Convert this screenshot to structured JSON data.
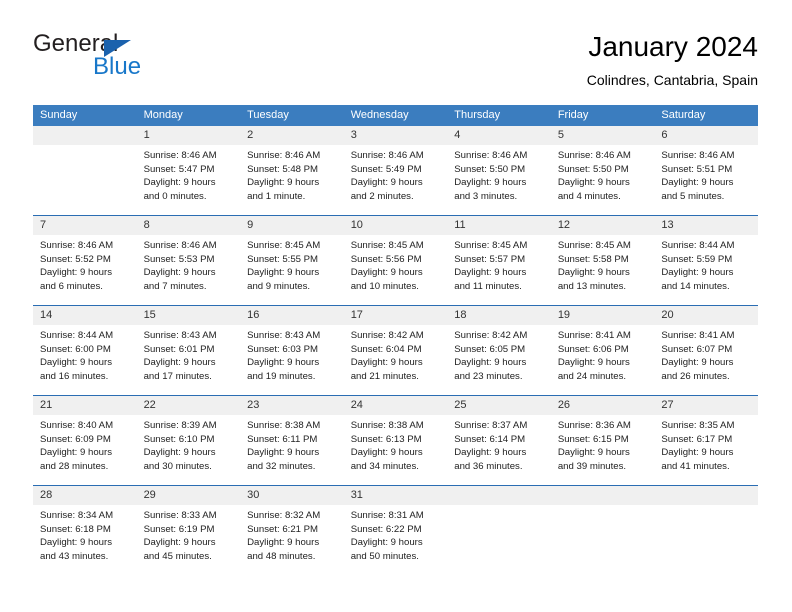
{
  "brand": {
    "name_part1": "General",
    "name_part2": "Blue",
    "color_primary": "#1877c9",
    "color_triangle": "#1b62ad",
    "color_text": "#231f20"
  },
  "header": {
    "title": "January 2024",
    "location": "Colindres, Cantabria, Spain"
  },
  "theme": {
    "header_row_bg": "#3b7dbf",
    "header_row_text": "#ffffff",
    "daynum_bg": "#f0f0f0",
    "week_divider": "#2a6db3"
  },
  "weekday_headers": [
    "Sunday",
    "Monday",
    "Tuesday",
    "Wednesday",
    "Thursday",
    "Friday",
    "Saturday"
  ],
  "weeks": [
    [
      {
        "day": "",
        "sunrise": "",
        "sunset": "",
        "daylight_line1": "",
        "daylight_line2": ""
      },
      {
        "day": "1",
        "sunrise": "Sunrise: 8:46 AM",
        "sunset": "Sunset: 5:47 PM",
        "daylight_line1": "Daylight: 9 hours",
        "daylight_line2": "and 0 minutes."
      },
      {
        "day": "2",
        "sunrise": "Sunrise: 8:46 AM",
        "sunset": "Sunset: 5:48 PM",
        "daylight_line1": "Daylight: 9 hours",
        "daylight_line2": "and 1 minute."
      },
      {
        "day": "3",
        "sunrise": "Sunrise: 8:46 AM",
        "sunset": "Sunset: 5:49 PM",
        "daylight_line1": "Daylight: 9 hours",
        "daylight_line2": "and 2 minutes."
      },
      {
        "day": "4",
        "sunrise": "Sunrise: 8:46 AM",
        "sunset": "Sunset: 5:50 PM",
        "daylight_line1": "Daylight: 9 hours",
        "daylight_line2": "and 3 minutes."
      },
      {
        "day": "5",
        "sunrise": "Sunrise: 8:46 AM",
        "sunset": "Sunset: 5:50 PM",
        "daylight_line1": "Daylight: 9 hours",
        "daylight_line2": "and 4 minutes."
      },
      {
        "day": "6",
        "sunrise": "Sunrise: 8:46 AM",
        "sunset": "Sunset: 5:51 PM",
        "daylight_line1": "Daylight: 9 hours",
        "daylight_line2": "and 5 minutes."
      }
    ],
    [
      {
        "day": "7",
        "sunrise": "Sunrise: 8:46 AM",
        "sunset": "Sunset: 5:52 PM",
        "daylight_line1": "Daylight: 9 hours",
        "daylight_line2": "and 6 minutes."
      },
      {
        "day": "8",
        "sunrise": "Sunrise: 8:46 AM",
        "sunset": "Sunset: 5:53 PM",
        "daylight_line1": "Daylight: 9 hours",
        "daylight_line2": "and 7 minutes."
      },
      {
        "day": "9",
        "sunrise": "Sunrise: 8:45 AM",
        "sunset": "Sunset: 5:55 PM",
        "daylight_line1": "Daylight: 9 hours",
        "daylight_line2": "and 9 minutes."
      },
      {
        "day": "10",
        "sunrise": "Sunrise: 8:45 AM",
        "sunset": "Sunset: 5:56 PM",
        "daylight_line1": "Daylight: 9 hours",
        "daylight_line2": "and 10 minutes."
      },
      {
        "day": "11",
        "sunrise": "Sunrise: 8:45 AM",
        "sunset": "Sunset: 5:57 PM",
        "daylight_line1": "Daylight: 9 hours",
        "daylight_line2": "and 11 minutes."
      },
      {
        "day": "12",
        "sunrise": "Sunrise: 8:45 AM",
        "sunset": "Sunset: 5:58 PM",
        "daylight_line1": "Daylight: 9 hours",
        "daylight_line2": "and 13 minutes."
      },
      {
        "day": "13",
        "sunrise": "Sunrise: 8:44 AM",
        "sunset": "Sunset: 5:59 PM",
        "daylight_line1": "Daylight: 9 hours",
        "daylight_line2": "and 14 minutes."
      }
    ],
    [
      {
        "day": "14",
        "sunrise": "Sunrise: 8:44 AM",
        "sunset": "Sunset: 6:00 PM",
        "daylight_line1": "Daylight: 9 hours",
        "daylight_line2": "and 16 minutes."
      },
      {
        "day": "15",
        "sunrise": "Sunrise: 8:43 AM",
        "sunset": "Sunset: 6:01 PM",
        "daylight_line1": "Daylight: 9 hours",
        "daylight_line2": "and 17 minutes."
      },
      {
        "day": "16",
        "sunrise": "Sunrise: 8:43 AM",
        "sunset": "Sunset: 6:03 PM",
        "daylight_line1": "Daylight: 9 hours",
        "daylight_line2": "and 19 minutes."
      },
      {
        "day": "17",
        "sunrise": "Sunrise: 8:42 AM",
        "sunset": "Sunset: 6:04 PM",
        "daylight_line1": "Daylight: 9 hours",
        "daylight_line2": "and 21 minutes."
      },
      {
        "day": "18",
        "sunrise": "Sunrise: 8:42 AM",
        "sunset": "Sunset: 6:05 PM",
        "daylight_line1": "Daylight: 9 hours",
        "daylight_line2": "and 23 minutes."
      },
      {
        "day": "19",
        "sunrise": "Sunrise: 8:41 AM",
        "sunset": "Sunset: 6:06 PM",
        "daylight_line1": "Daylight: 9 hours",
        "daylight_line2": "and 24 minutes."
      },
      {
        "day": "20",
        "sunrise": "Sunrise: 8:41 AM",
        "sunset": "Sunset: 6:07 PM",
        "daylight_line1": "Daylight: 9 hours",
        "daylight_line2": "and 26 minutes."
      }
    ],
    [
      {
        "day": "21",
        "sunrise": "Sunrise: 8:40 AM",
        "sunset": "Sunset: 6:09 PM",
        "daylight_line1": "Daylight: 9 hours",
        "daylight_line2": "and 28 minutes."
      },
      {
        "day": "22",
        "sunrise": "Sunrise: 8:39 AM",
        "sunset": "Sunset: 6:10 PM",
        "daylight_line1": "Daylight: 9 hours",
        "daylight_line2": "and 30 minutes."
      },
      {
        "day": "23",
        "sunrise": "Sunrise: 8:38 AM",
        "sunset": "Sunset: 6:11 PM",
        "daylight_line1": "Daylight: 9 hours",
        "daylight_line2": "and 32 minutes."
      },
      {
        "day": "24",
        "sunrise": "Sunrise: 8:38 AM",
        "sunset": "Sunset: 6:13 PM",
        "daylight_line1": "Daylight: 9 hours",
        "daylight_line2": "and 34 minutes."
      },
      {
        "day": "25",
        "sunrise": "Sunrise: 8:37 AM",
        "sunset": "Sunset: 6:14 PM",
        "daylight_line1": "Daylight: 9 hours",
        "daylight_line2": "and 36 minutes."
      },
      {
        "day": "26",
        "sunrise": "Sunrise: 8:36 AM",
        "sunset": "Sunset: 6:15 PM",
        "daylight_line1": "Daylight: 9 hours",
        "daylight_line2": "and 39 minutes."
      },
      {
        "day": "27",
        "sunrise": "Sunrise: 8:35 AM",
        "sunset": "Sunset: 6:17 PM",
        "daylight_line1": "Daylight: 9 hours",
        "daylight_line2": "and 41 minutes."
      }
    ],
    [
      {
        "day": "28",
        "sunrise": "Sunrise: 8:34 AM",
        "sunset": "Sunset: 6:18 PM",
        "daylight_line1": "Daylight: 9 hours",
        "daylight_line2": "and 43 minutes."
      },
      {
        "day": "29",
        "sunrise": "Sunrise: 8:33 AM",
        "sunset": "Sunset: 6:19 PM",
        "daylight_line1": "Daylight: 9 hours",
        "daylight_line2": "and 45 minutes."
      },
      {
        "day": "30",
        "sunrise": "Sunrise: 8:32 AM",
        "sunset": "Sunset: 6:21 PM",
        "daylight_line1": "Daylight: 9 hours",
        "daylight_line2": "and 48 minutes."
      },
      {
        "day": "31",
        "sunrise": "Sunrise: 8:31 AM",
        "sunset": "Sunset: 6:22 PM",
        "daylight_line1": "Daylight: 9 hours",
        "daylight_line2": "and 50 minutes."
      },
      {
        "day": "",
        "sunrise": "",
        "sunset": "",
        "daylight_line1": "",
        "daylight_line2": ""
      },
      {
        "day": "",
        "sunrise": "",
        "sunset": "",
        "daylight_line1": "",
        "daylight_line2": ""
      },
      {
        "day": "",
        "sunrise": "",
        "sunset": "",
        "daylight_line1": "",
        "daylight_line2": ""
      }
    ]
  ]
}
